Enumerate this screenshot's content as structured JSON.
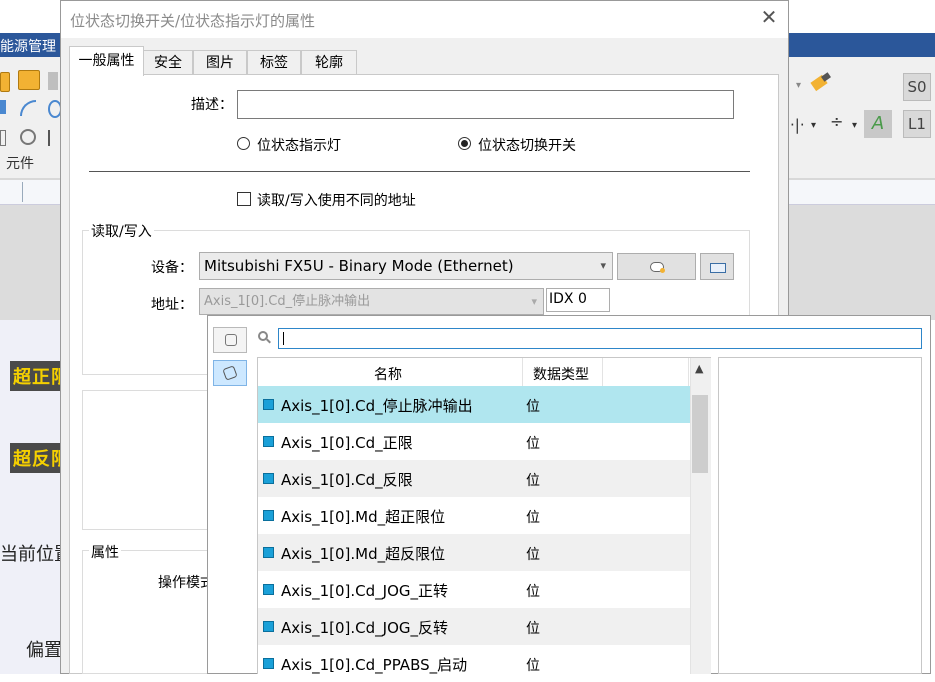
{
  "background_app": {
    "title": "能源管理",
    "group_label": "元件",
    "side_buttons": [
      "S0",
      "L1"
    ],
    "lamps": [
      "超正限",
      "超反限"
    ],
    "labels": [
      "当前位置",
      "偏置"
    ]
  },
  "dialog": {
    "title": "位状态切换开关/位状态指示灯的属性",
    "close_icon": "close-icon",
    "tabs": [
      {
        "label": "一般属性",
        "active": true
      },
      {
        "label": "安全",
        "active": false
      },
      {
        "label": "图片",
        "active": false
      },
      {
        "label": "标签",
        "active": false
      },
      {
        "label": "轮廓",
        "active": false
      }
    ],
    "description_label": "描述：",
    "description_value": "",
    "radio_indicator": "位状态指示灯",
    "radio_switch": "位状态切换开关",
    "radio_selected": "位状态切换开关",
    "checkbox_label": "读取/写入使用不同的地址",
    "checkbox_checked": false,
    "rw_group_title": "读取/写入",
    "device_label": "设备：",
    "device_value": "Mitsubishi FX5U - Binary Mode (Ethernet)",
    "address_label": "地址：",
    "address_value": "Axis_1[0].Cd_停止脉冲输出",
    "idx_value": "IDX 0",
    "props_group_title": "属性",
    "op_mode_label": "操作模式"
  },
  "tag_picker": {
    "search_placeholder": "",
    "search_value": "",
    "columns": [
      "名称",
      "数据类型"
    ],
    "rows": [
      {
        "name": "Axis_1[0].Cd_停止脉冲输出",
        "type": "位",
        "selected": true
      },
      {
        "name": "Axis_1[0].Cd_正限",
        "type": "位",
        "selected": false
      },
      {
        "name": "Axis_1[0].Cd_反限",
        "type": "位",
        "selected": false
      },
      {
        "name": "Axis_1[0].Md_超正限位",
        "type": "位",
        "selected": false
      },
      {
        "name": "Axis_1[0].Md_超反限位",
        "type": "位",
        "selected": false
      },
      {
        "name": "Axis_1[0].Cd_JOG_正转",
        "type": "位",
        "selected": false
      },
      {
        "name": "Axis_1[0].Cd_JOG_反转",
        "type": "位",
        "selected": false
      },
      {
        "name": "Axis_1[0].Cd_PPABS_启动",
        "type": "位",
        "selected": false
      }
    ]
  },
  "colors": {
    "app_titlebar": "#2b579a",
    "selected_row": "#b0e6ef",
    "search_border": "#2e86c9",
    "lamp_text": "#f5d000"
  }
}
